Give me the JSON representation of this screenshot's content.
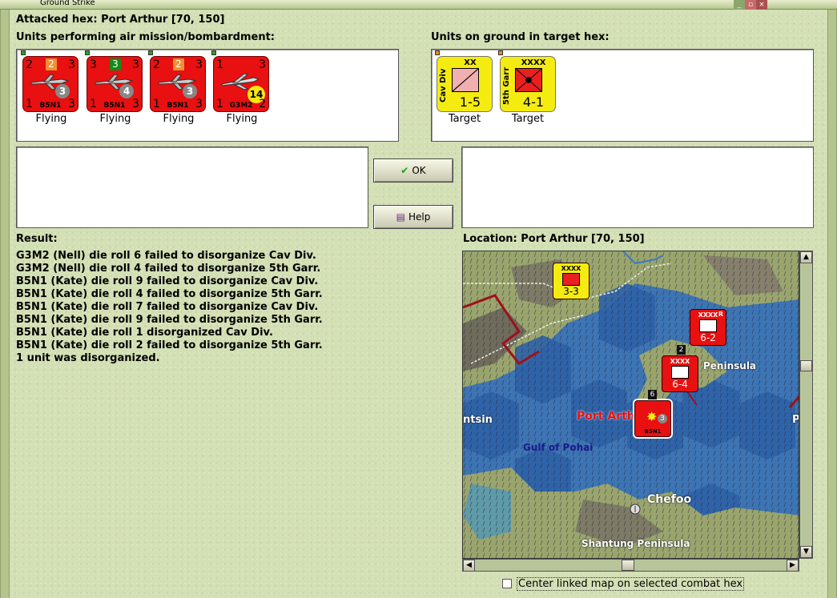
{
  "window": {
    "title": "Ground Strike"
  },
  "header": {
    "attacked_hex_label": "Attacked hex:",
    "attacked_hex_value": "Port Arthur  [70, 150]"
  },
  "air_panel": {
    "title": "Units performing air mission/bombardment:",
    "units": [
      {
        "model": "B5N1",
        "top_left": "2",
        "top_right": "3",
        "bottom_left": "1",
        "bottom_right": "3",
        "chip": "2",
        "circle": "3",
        "status": "Flying"
      },
      {
        "model": "B5N1",
        "top_left": "3",
        "top_right": "3",
        "bottom_left": "1",
        "bottom_right": "3",
        "chip": "3",
        "circle": "4",
        "status": "Flying"
      },
      {
        "model": "B5N1",
        "top_left": "2",
        "top_right": "3",
        "bottom_left": "1",
        "bottom_right": "3",
        "chip": "2",
        "circle": "3",
        "status": "Flying"
      },
      {
        "model": "G3M2",
        "top_left": "1",
        "top_right": "3",
        "bottom_left": "1",
        "bottom_right": "2",
        "chip": "",
        "circle": "14",
        "status": "Flying"
      }
    ]
  },
  "ground_panel": {
    "title": "Units on ground in target hex:",
    "units": [
      {
        "name": "Cav Div",
        "size": "XX",
        "strength": "1-5",
        "status": "Target"
      },
      {
        "name": "5th Garr",
        "size": "XXXX",
        "strength": "4-1",
        "status": "Target"
      }
    ]
  },
  "buttons": {
    "ok": "OK",
    "help": "Help"
  },
  "result": {
    "title": "Result:",
    "lines": [
      "G3M2 (Nell) die roll 6 failed to disorganize Cav Div.",
      "G3M2 (Nell) die roll 4 failed to disorganize 5th Garr.",
      "B5N1 (Kate) die roll 9 failed to disorganize Cav Div.",
      "B5N1 (Kate) die roll 4 failed to disorganize 5th Garr.",
      "B5N1 (Kate) die roll 7 failed to disorganize Cav Div.",
      "B5N1 (Kate) die roll 9 failed to disorganize 5th Garr.",
      "B5N1 (Kate) die roll 1 disorganized Cav Div.",
      "B5N1 (Kate) die roll 2 failed to disorganize 5th Garr.",
      "1 unit was disorganized."
    ]
  },
  "location": {
    "label": "Location:",
    "value": "Port Arthur  [70, 150]"
  },
  "map": {
    "labels": {
      "port_arthur": "Port Arthur",
      "gulf": "Gulf of Pohai",
      "chefoo": "Chefoo",
      "shantung": "Shantung Peninsula",
      "tsin": "ntsin",
      "peninsula": "Peninsula",
      "p_edge": "P"
    },
    "counters": [
      {
        "size": "XXXX",
        "strength": "3-3",
        "color": "#f4ec10"
      },
      {
        "size": "XXXX",
        "strength": "6-2",
        "color": "#e81010",
        "badge": "R"
      },
      {
        "size": "XXXX",
        "strength": "6-4",
        "color": "#e81010",
        "stack": "2"
      },
      {
        "model": "B5N1",
        "circle": "3",
        "color": "#e81010",
        "stack": "6"
      }
    ]
  },
  "options": {
    "center_map": "Center linked map on selected combat hex"
  }
}
